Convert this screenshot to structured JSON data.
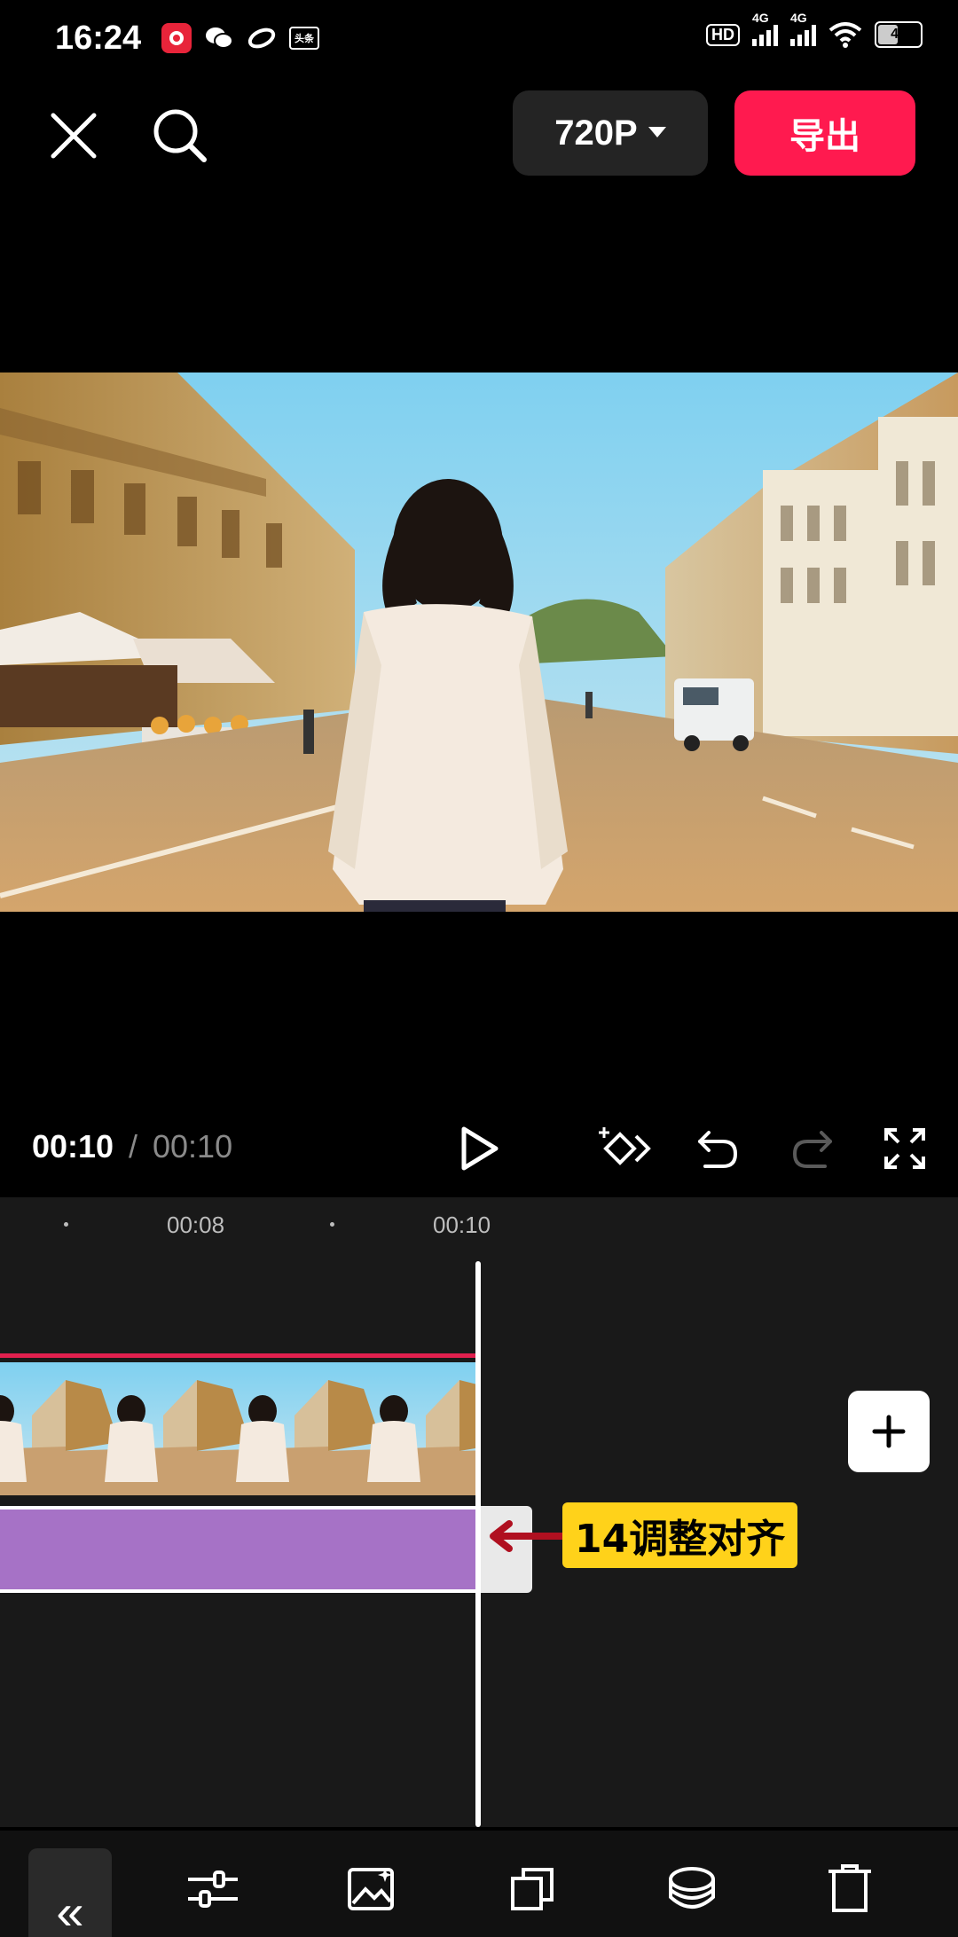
{
  "status_bar": {
    "time": "16:24",
    "hd_label": "HD",
    "net1": "4G",
    "net2": "4G",
    "battery": "47",
    "app_badge": "头条"
  },
  "top_bar": {
    "resolution": "720P",
    "export_label": "导出"
  },
  "playback": {
    "current_time": "00:10",
    "separator": "/",
    "total_time": "00:10"
  },
  "timeline": {
    "ticks": [
      "00:08",
      "00:10"
    ],
    "annotation": "14调整对齐"
  },
  "icons": {
    "collapse": "«"
  }
}
